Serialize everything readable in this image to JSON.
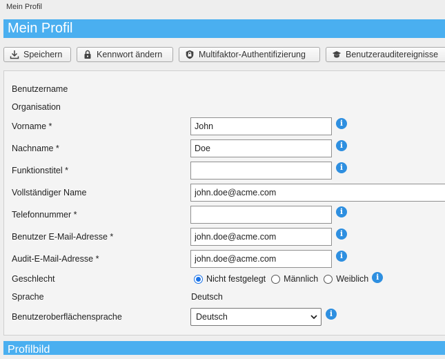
{
  "breadcrumb": "Mein Profil",
  "page_title": "Mein Profil",
  "toolbar": {
    "save": "Speichern",
    "change_password": "Kennwort ändern",
    "mfa": "Multifaktor-Authentifizierung",
    "audit_events": "Benutzerauditereignisse"
  },
  "form": {
    "username_label": "Benutzername",
    "organisation_label": "Organisation",
    "firstname_label": "Vorname *",
    "firstname_value": "John",
    "lastname_label": "Nachname *",
    "lastname_value": "Doe",
    "jobtitle_label": "Funktionstitel *",
    "jobtitle_value": "",
    "fullname_label": "Vollständiger Name",
    "fullname_value": "john.doe@acme.com",
    "phone_label": "Telefonnummer *",
    "phone_value": "",
    "email_label": "Benutzer E-Mail-Adresse *",
    "email_value": "john.doe@acme.com",
    "audit_email_label": "Audit-E-Mail-Adresse *",
    "audit_email_value": "john.doe@acme.com",
    "gender_label": "Geschlecht",
    "gender_options": [
      "Nicht festgelegt",
      "Männlich",
      "Weiblich"
    ],
    "gender_selected": "Nicht festgelegt",
    "language_label": "Sprache",
    "language_value": "Deutsch",
    "ui_language_label": "Benutzeroberflächensprache",
    "ui_language_value": "Deutsch"
  },
  "next_section_title": "Profilbild",
  "colors": {
    "title_bar": "#4aaff0",
    "info_icon": "#2e8fe0",
    "radio_selected": "#1a73e8"
  },
  "icons": {
    "save": "download-icon",
    "change_password": "lock-icon",
    "mfa": "shield-lock-icon",
    "audit_events": "graduation-cap-icon",
    "info": "info-icon"
  }
}
